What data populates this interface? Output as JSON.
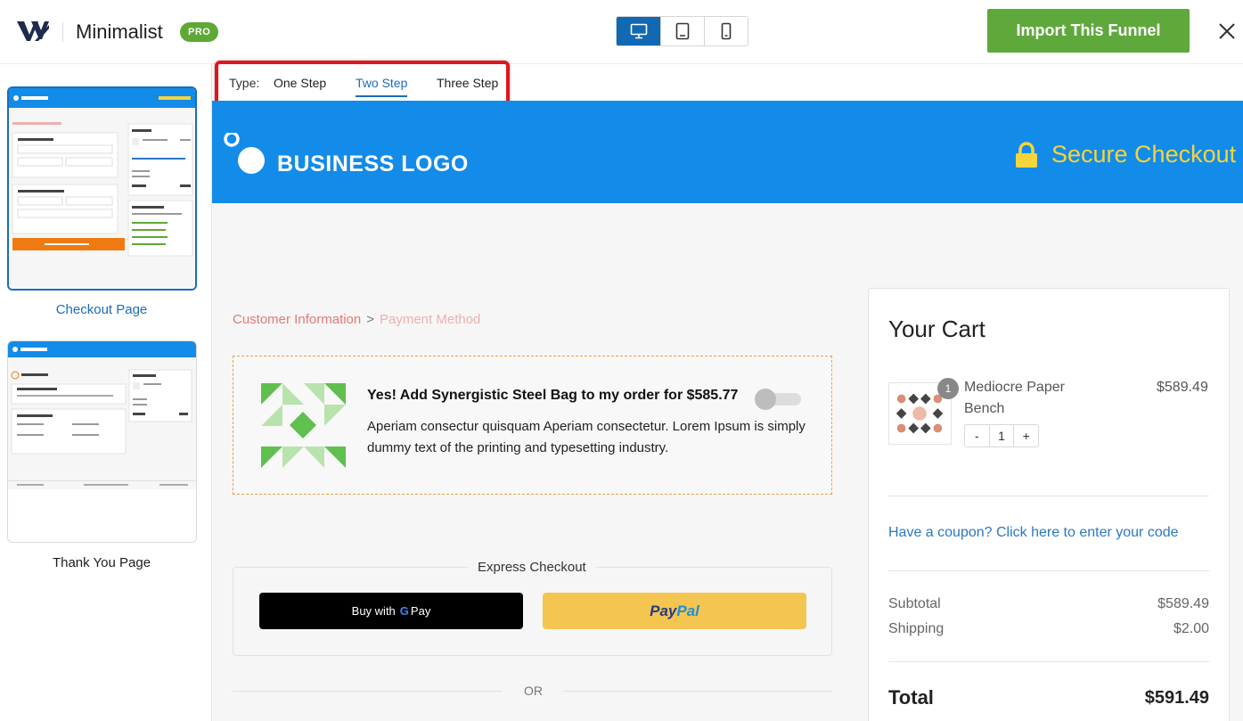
{
  "header": {
    "app_title": "Minimalist",
    "pro_badge": "PRO",
    "import_button": "Import This Funnel",
    "devices": [
      "desktop-icon",
      "tablet-icon",
      "mobile-icon"
    ],
    "active_device": "desktop"
  },
  "sidebar": {
    "pages": [
      {
        "label": "Checkout Page",
        "active": true
      },
      {
        "label": "Thank You Page",
        "active": false
      }
    ]
  },
  "type_bar": {
    "label": "Type:",
    "options": [
      "One Step",
      "Two Step",
      "Three Step"
    ],
    "selected": "Two Step"
  },
  "preview": {
    "brand": "BUSINESS LOGO",
    "secure": "Secure Checkout",
    "breadcrumb": [
      "Customer Information",
      "Payment Method"
    ],
    "breadcrumb_sep": ">",
    "order_bump": {
      "title": "Yes! Add Synergistic Steel Bag to my order for $585.77",
      "description": "Aperiam consectur quisquam Aperiam consectetur. Lorem Ipsum is simply dummy text of the printing and typesetting industry."
    },
    "express": {
      "label": "Express Checkout",
      "gpay_prefix": "Buy with",
      "gpay_g": "G",
      "gpay_suffix": "Pay",
      "paypal_a": "Pay",
      "paypal_b": "Pal"
    },
    "or_text": "OR",
    "cart": {
      "title": "Your Cart",
      "item": {
        "qty_badge": "1",
        "name": "Mediocre Paper Bench",
        "price": "$589.49",
        "qty": "1",
        "minus": "-",
        "plus": "+"
      },
      "coupon": "Have a coupon? Click here to enter your code",
      "subtotal_label": "Subtotal",
      "subtotal": "$589.49",
      "shipping_label": "Shipping",
      "shipping": "$2.00",
      "total_label": "Total",
      "total": "$591.49"
    }
  },
  "colors": {
    "accent": "#1168b3",
    "import_green": "#5fa83c",
    "banner_blue": "#138be9",
    "secure_yellow": "#f6d43b",
    "highlight_red": "#e4141c"
  }
}
